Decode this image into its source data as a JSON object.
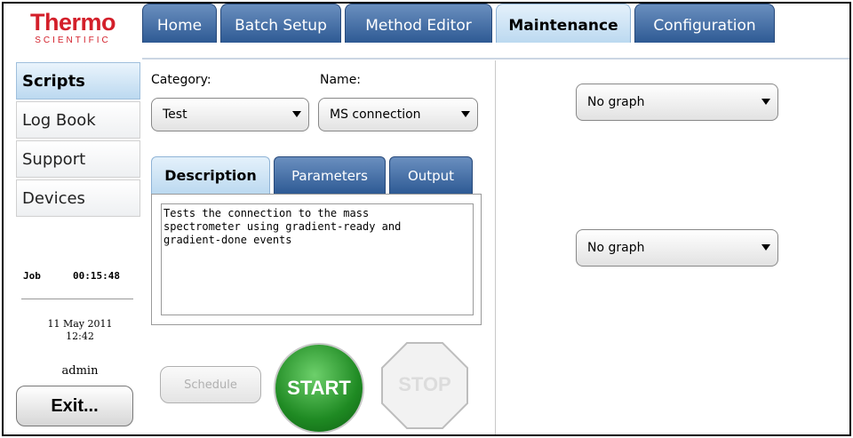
{
  "logo": {
    "main": "Thermo",
    "sub": "SCIENTIFIC"
  },
  "top_tabs": [
    {
      "label": "Home",
      "active": false
    },
    {
      "label": "Batch Setup",
      "active": false
    },
    {
      "label": "Method Editor",
      "active": false
    },
    {
      "label": "Maintenance",
      "active": true
    },
    {
      "label": "Configuration",
      "active": false
    }
  ],
  "sidebar": {
    "items": [
      {
        "label": "Scripts",
        "active": true
      },
      {
        "label": "Log Book",
        "active": false
      },
      {
        "label": "Support",
        "active": false
      },
      {
        "label": "Devices",
        "active": false
      }
    ],
    "job_label": "Job",
    "job_time": "00:15:48",
    "date": "11 May 2011",
    "time": "12:42",
    "user": "admin",
    "exit_label": "Exit..."
  },
  "script_panel": {
    "category_label": "Category:",
    "category_value": "Test",
    "name_label": "Name:",
    "name_value": "MS connection",
    "tabs": [
      {
        "label": "Description",
        "active": true
      },
      {
        "label": "Parameters",
        "active": false
      },
      {
        "label": "Output",
        "active": false
      }
    ],
    "description": "Tests the connection to the mass\nspectrometer using gradient-ready and\ngradient-done events",
    "schedule_label": "Schedule",
    "start_label": "START",
    "stop_label": "STOP"
  },
  "graph_panel": {
    "graph1_value": "No graph",
    "graph2_value": "No graph"
  },
  "colors": {
    "brand_red": "#d31f2a",
    "tab_blue": "#2e5a94",
    "tab_active": "#bcd9f0",
    "start_green": "#1f8a23"
  }
}
